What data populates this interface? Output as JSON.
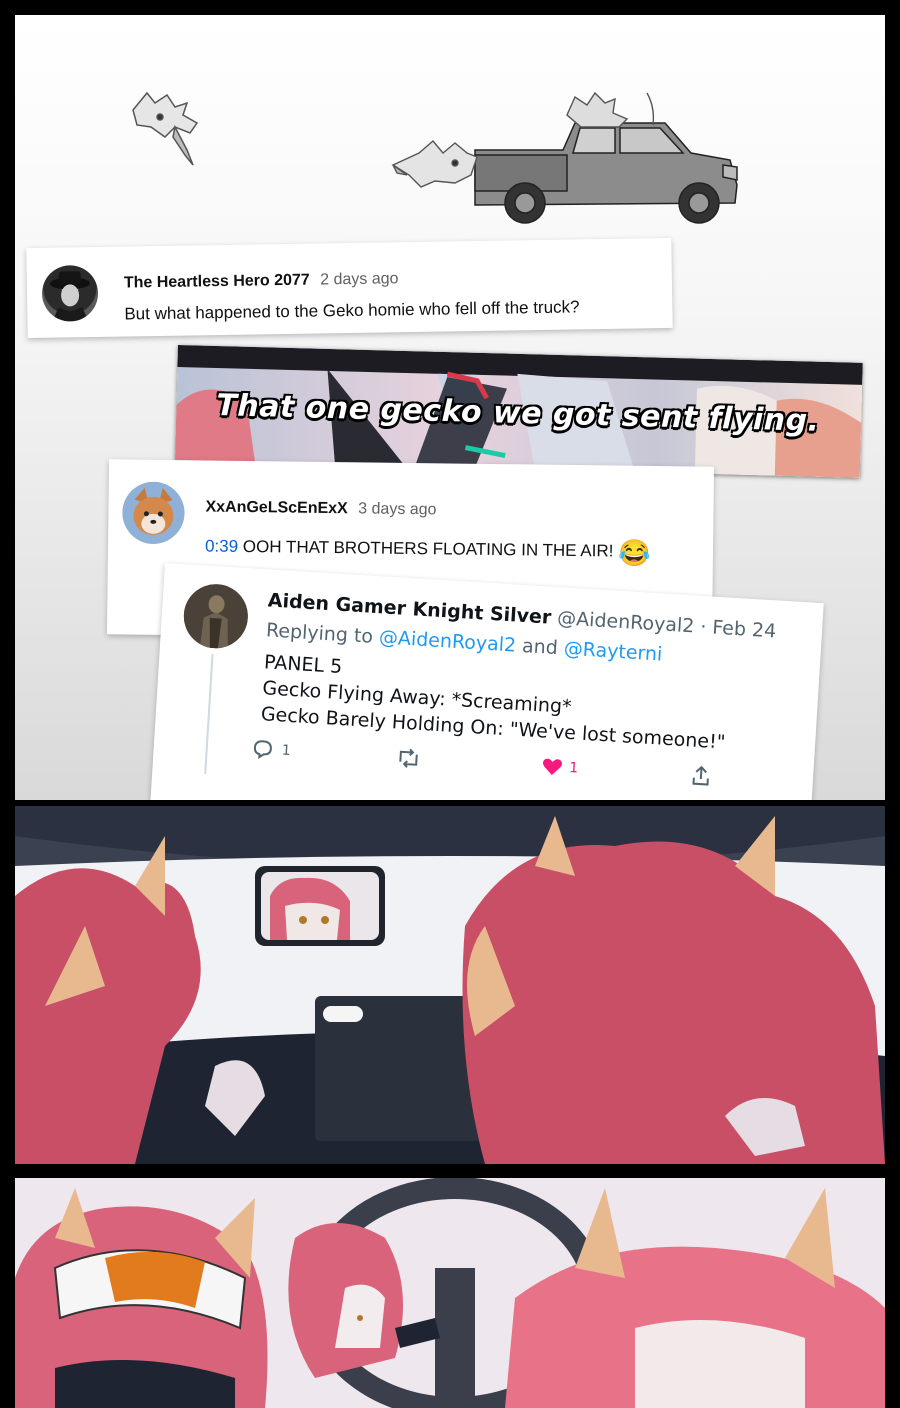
{
  "comment_1": {
    "author": "The Heartless Hero 2077",
    "time": "2 days ago",
    "text": "But what happened to the Geko homie who fell off the truck?"
  },
  "video_caption": {
    "text": "That one gecko we got sent flying."
  },
  "comment_2": {
    "author": "XxAnGeLScEnExX",
    "time": "3 days ago",
    "timestamp_link": "0:39",
    "text": "OOH THAT BROTHERS FLOATING IN THE AIR!",
    "emoji": "😂"
  },
  "tweet": {
    "display_name": "Aiden Gamer Knight Silver",
    "handle": "@AidenRoyal2",
    "date": "· Feb 24",
    "replying_prefix": "Replying to",
    "replying_to_1": "@AidenRoyal2",
    "replying_and": "and",
    "replying_to_2": "@Rayterni",
    "line_1": "PANEL 5",
    "line_2": "Gecko Flying Away: *Screaming*",
    "line_3": "Gecko Barely Holding On: \"We've lost someone!\"",
    "reply_count": "1",
    "like_count": "1"
  },
  "colors": {
    "page_border": "#000000",
    "link_blue": "#1d9bf0",
    "yt_link_blue": "#065fd4",
    "character_hair": "#d9637a",
    "character_horn": "#e8b98f",
    "like_pink": "#f91880"
  }
}
